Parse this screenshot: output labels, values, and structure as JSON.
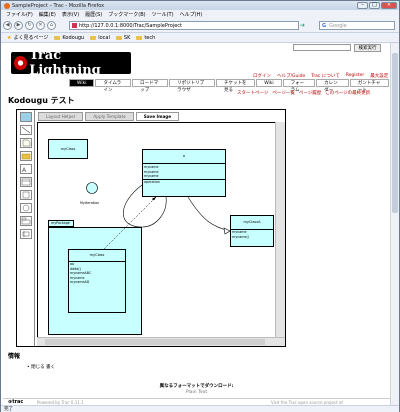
{
  "browser": {
    "title": "SampleProject – Trac - Mozilla Firefox",
    "menu": [
      "ファイル(F)",
      "編集(E)",
      "表示(V)",
      "履歴(S)",
      "ブックマーク(B)",
      "ツール(T)",
      "ヘルプ(H)"
    ],
    "url": "http://127.0.0.1:8000/Trac/SampleProject",
    "search_placeholder": "Google",
    "bookmarks": [
      "よく見るページ",
      "Kodougu",
      "local",
      "SK",
      "tech"
    ],
    "status": "完了"
  },
  "trac": {
    "search_button": "検索実行",
    "metanav": [
      "ログイン",
      "ヘルプ/Guide",
      "Trac について",
      "Register",
      "最大設定"
    ],
    "logo_text": "Trac Lightning",
    "mainnav": [
      "Wiki",
      "タイムライン",
      "ロードマップ",
      "リポジトリブラウザ",
      "チケットを見る",
      "Wiki",
      "フォーラム",
      "カレンダー",
      "ガントチャート"
    ],
    "ctxnav": [
      "スタートページ",
      "ページ一覧",
      "ページ履歴",
      "このページの最終更新"
    ],
    "page_title": "Kodougu テスト",
    "tabs": [
      "Layout Helper",
      "Apply Template",
      "Save Image"
    ],
    "info_heading": "情報",
    "info_item": "閉じる 書く",
    "download_label": "異なるフォーマットでダウンロード:",
    "download_format": "Plain Text",
    "footer_left": "Powered by Trac 0.11.1",
    "footer_right": "Visit the Trac open source project at"
  },
  "uml": {
    "myclass": "myClass",
    "actor": "MyIteration",
    "center_title": "a",
    "center_attrs": [
      "myname",
      "myname",
      "myname"
    ],
    "center_op": "operation",
    "package_tab": "myPackage",
    "pkg_class_title": "myClass",
    "pkg_class_rows": [
      "aa",
      "dddd()",
      "mynameABC",
      "myname",
      "mynameAD"
    ],
    "classA_title": "myClassA",
    "classA_rows": [
      "myname",
      "myname()"
    ]
  },
  "colors": {
    "uml_fill": "#c8ffff",
    "trac_red": "#bb0000",
    "active_tab": "#000000"
  }
}
